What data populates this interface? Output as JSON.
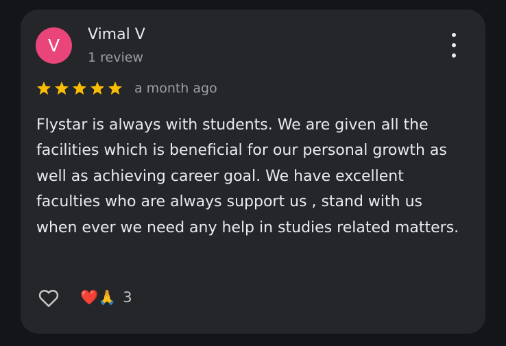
{
  "review": {
    "avatar_initial": "V",
    "reviewer_name": "Vimal V",
    "review_count": "1 review",
    "rating": 5,
    "timestamp": "a month ago",
    "text": "Flystar is always with students. We are given all the facilities which is beneficial for our personal growth as well as achieving career goal. We have excellent faculties who are always support us , stand with us when ever we need any help in studies related matters.",
    "reactions": {
      "emojis": "❤️🙏",
      "count": "3"
    }
  },
  "icons": {
    "more": "more-vert-icon",
    "star": "star-icon",
    "like": "heart-outline-icon"
  },
  "colors": {
    "background": "#141518",
    "card": "#25262a",
    "avatar": "#e9457a",
    "star": "#fbbc04",
    "primary_text": "#e8eaed",
    "secondary_text": "#9aa0a6"
  }
}
